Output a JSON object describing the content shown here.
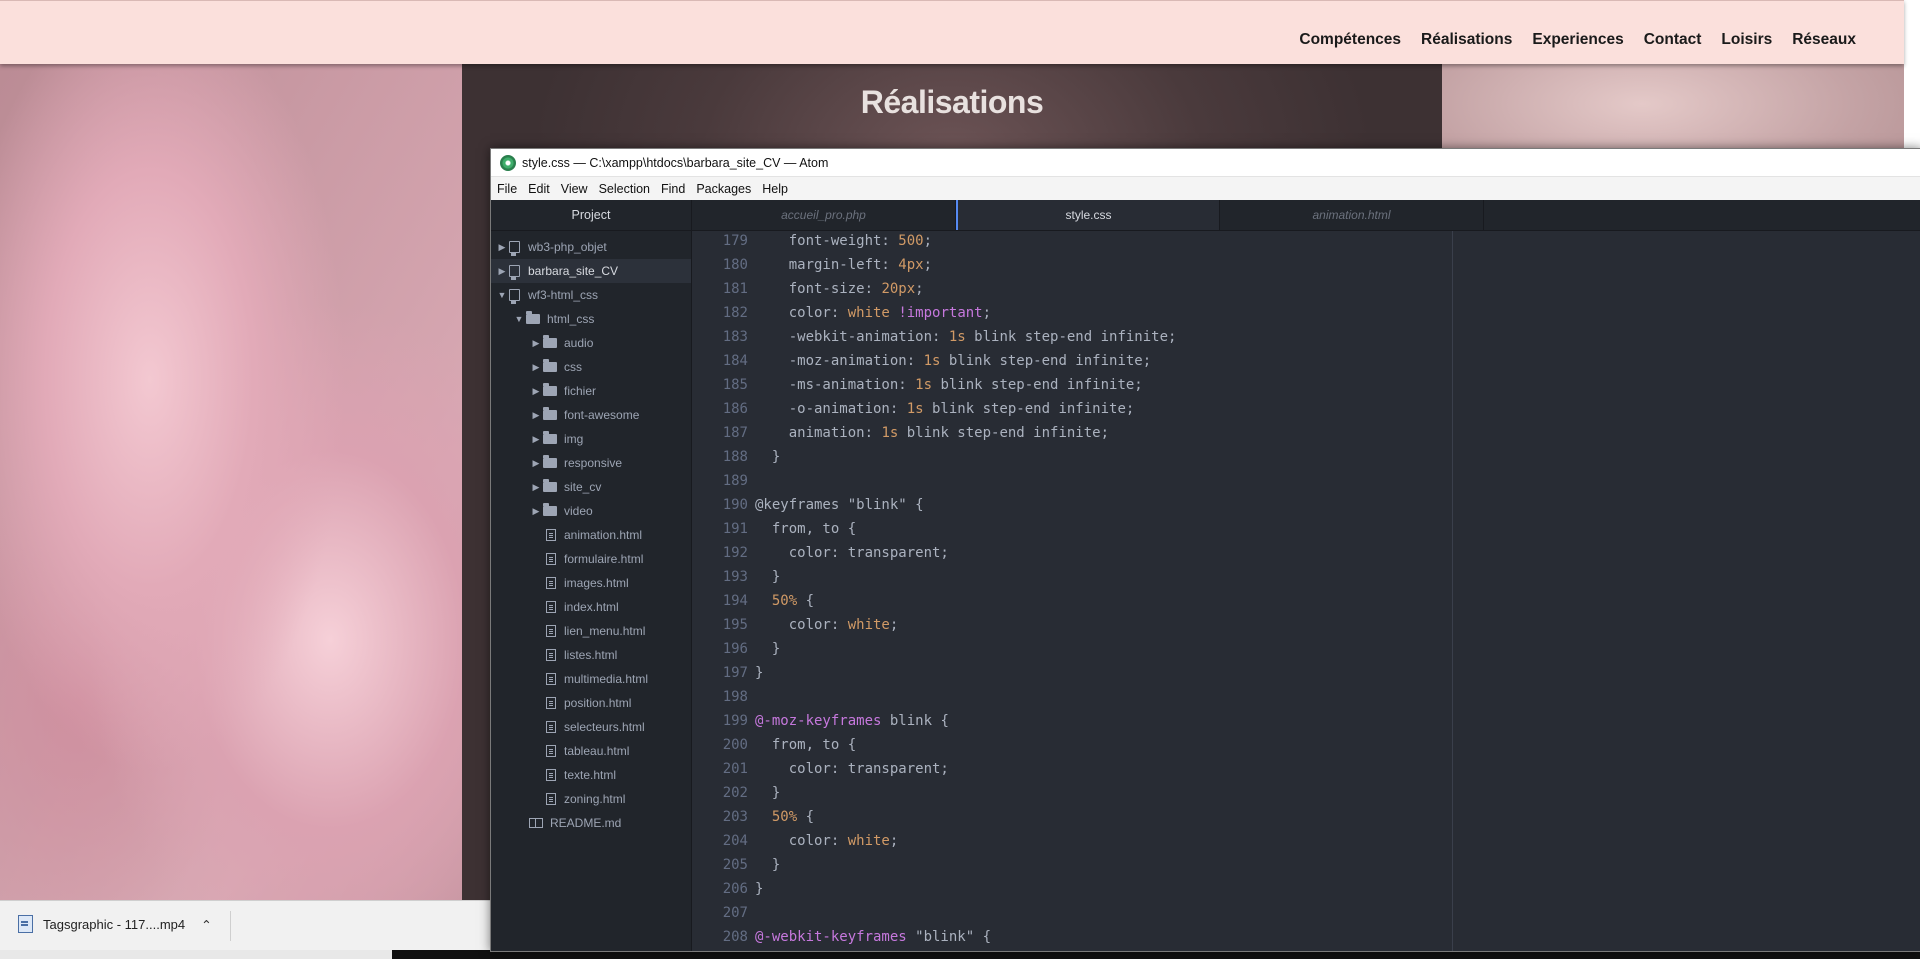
{
  "site": {
    "nav": [
      "Compétences",
      "Réalisations",
      "Experiences",
      "Contact",
      "Loisirs",
      "Réseaux"
    ],
    "section_title": "Réalisations"
  },
  "download_bar": {
    "filename": "Tagsgraphic - 117....mp4"
  },
  "atom": {
    "title": "style.css — C:\\xampp\\htdocs\\barbara_site_CV — Atom",
    "menu": [
      "File",
      "Edit",
      "View",
      "Selection",
      "Find",
      "Packages",
      "Help"
    ],
    "tree_header": "Project",
    "tabs": [
      {
        "label": "accueil_pro.php",
        "active": false
      },
      {
        "label": "style.css",
        "active": true
      },
      {
        "label": "animation.html",
        "active": false
      }
    ],
    "projects": [
      {
        "name": "wb3-php_objet",
        "expanded": false
      },
      {
        "name": "barbara_site_CV",
        "expanded": false,
        "selected": true
      },
      {
        "name": "wf3-html_css",
        "expanded": true
      }
    ],
    "root_folder": "html_css",
    "folders": [
      "audio",
      "css",
      "fichier",
      "font-awesome",
      "img",
      "responsive",
      "site_cv",
      "video"
    ],
    "files": [
      "animation.html",
      "formulaire.html",
      "images.html",
      "index.html",
      "lien_menu.html",
      "listes.html",
      "multimedia.html",
      "position.html",
      "selecteurs.html",
      "tableau.html",
      "texte.html",
      "zoning.html"
    ],
    "readme": "README.md",
    "code": {
      "line_numbers": [
        "179",
        "180",
        "181",
        "182",
        "183",
        "184",
        "185",
        "186",
        "187",
        "188",
        "189",
        "190",
        "191",
        "192",
        "193",
        "194",
        "195",
        "196",
        "197",
        "198",
        "199",
        "200",
        "201",
        "202",
        "203",
        "204",
        "205",
        "206",
        "207",
        "208"
      ],
      "lines": [
        "    font-weight: 500;",
        "    margin-left: 4px;",
        "    font-size: 20px;",
        "    color: white !important;",
        "    -webkit-animation: 1s blink step-end infinite;",
        "    -moz-animation: 1s blink step-end infinite;",
        "    -ms-animation: 1s blink step-end infinite;",
        "    -o-animation: 1s blink step-end infinite;",
        "    animation: 1s blink step-end infinite;",
        "  }",
        "",
        "@keyframes \"blink\" {",
        "  from, to {",
        "    color: transparent;",
        "  }",
        "  50% {",
        "    color: white;",
        "  }",
        "}",
        "",
        "@-moz-keyframes blink {",
        "  from, to {",
        "    color: transparent;",
        "  }",
        "  50% {",
        "    color: white;",
        "  }",
        "}",
        "",
        "@-webkit-keyframes \"blink\" {"
      ]
    }
  },
  "colors": {
    "nav_bg": "#fbe0dc",
    "editor_bg": "#282c34",
    "tree_bg": "#21252b",
    "keyword": "#c678dd",
    "number": "#d19a66",
    "accent": "#568af2"
  }
}
